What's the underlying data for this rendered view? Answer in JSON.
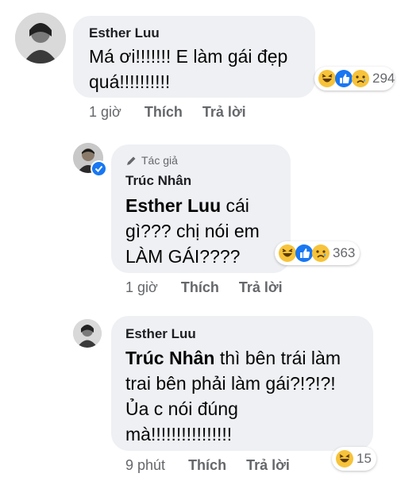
{
  "comments": [
    {
      "author": "Esther Luu",
      "line1": "Má ơi!!!!!!! E làm gái đẹp",
      "line2": "quá!!!!!!!!!!",
      "reactions_count": "294",
      "time": "1 giờ",
      "like_label": "Thích",
      "reply_label": "Trả lời"
    },
    {
      "author_tag": "Tác giả",
      "author": "Trúc Nhân",
      "mention": "Esther Luu",
      "line1_rest": " cái",
      "line2": "gì??? chị nói em",
      "line3": "LÀM GÁI????",
      "reactions_count": "363",
      "time": "1 giờ",
      "like_label": "Thích",
      "reply_label": "Trả lời"
    },
    {
      "author": "Esther Luu",
      "mention": "Trúc Nhân",
      "line1_rest": " thì bên trái làm",
      "line2": "trai bên phải làm gái?!?!?!",
      "line3": "Ủa c nói đúng",
      "line4": "mà!!!!!!!!!!!!!!!!",
      "reactions_count": "15",
      "time": "9 phút",
      "like_label": "Thích",
      "reply_label": "Trả lời"
    }
  ],
  "reaction_icons": [
    "haha-icon",
    "like-icon",
    "sad-icon"
  ],
  "colors": {
    "bubble": "#eef0f3",
    "link": "#65676b",
    "like_blue": "#1877f2",
    "emoji_yellow": "#f7c33a"
  }
}
